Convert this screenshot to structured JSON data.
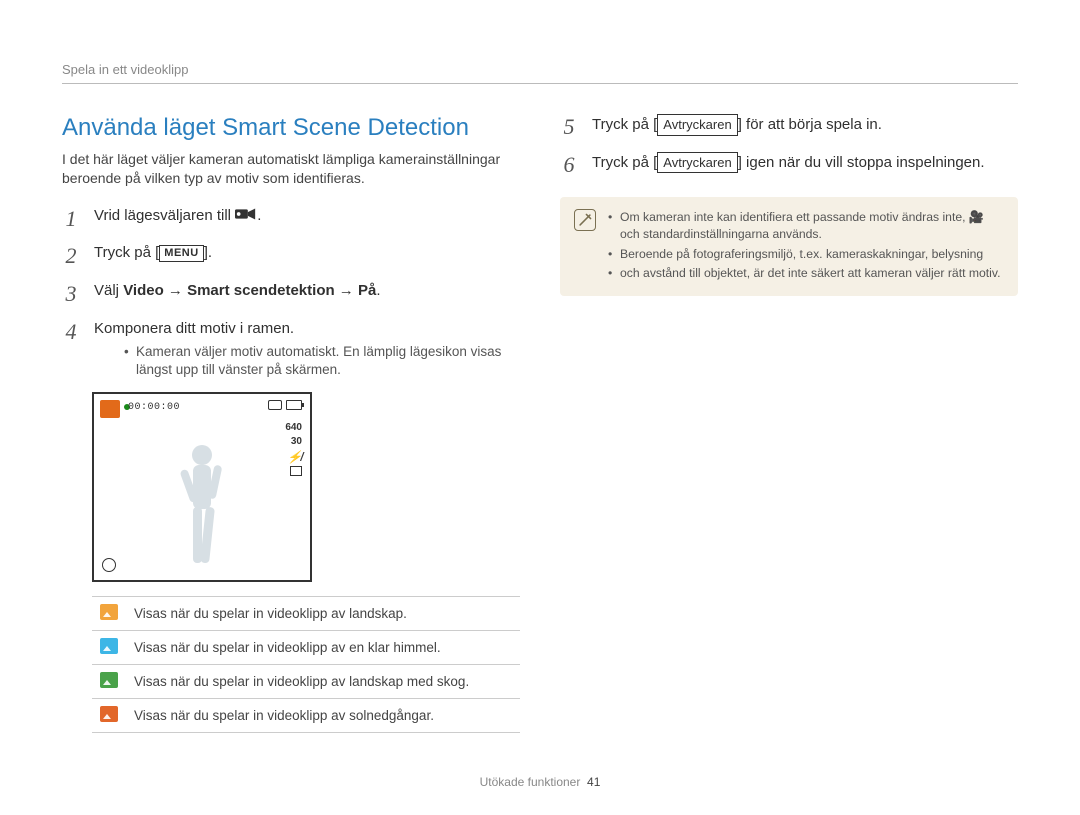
{
  "breadcrumb": "Spela in ett videoklipp",
  "section_title": "Använda läget Smart Scene Detection",
  "intro": "I det här läget väljer kameran automatiskt lämpliga kamerainställningar beroende på vilken typ av motiv som identifieras.",
  "left_steps": {
    "s1": {
      "num": "1",
      "text": "Vrid lägesväljaren till "
    },
    "s2": {
      "num": "2",
      "text_pre": "Tryck på [",
      "menu": "MENU",
      "text_post": "]."
    },
    "s3": {
      "num": "3",
      "text_pre": "Välj ",
      "bold": "Video → Smart scendetektion → På",
      "text_post": "."
    },
    "s4": {
      "num": "4",
      "text": "Komponera ditt motiv i ramen.",
      "bullet": "Kameran väljer motiv automatiskt. En lämplig lägesikon visas längst upp till vänster på skärmen."
    }
  },
  "display": {
    "time": "00:00:00",
    "res": "640",
    "fps": "30"
  },
  "icon_rows": [
    {
      "type": "landscape",
      "text": "Visas när du spelar in videoklipp av landskap."
    },
    {
      "type": "sky",
      "text": "Visas när du spelar in videoklipp av en klar himmel."
    },
    {
      "type": "forest",
      "text": "Visas när du spelar in videoklipp av landskap med skog."
    },
    {
      "type": "sunset",
      "text": "Visas när du spelar in videoklipp av solnedgångar."
    }
  ],
  "right_steps": {
    "s5": {
      "num": "5",
      "pre": "Tryck på [",
      "box": "Avtryckaren",
      "post": "] för att börja spela in."
    },
    "s6": {
      "num": "6",
      "pre": "Tryck på [",
      "box": "Avtryckaren",
      "post": "] igen när du vill stoppa inspelningen."
    }
  },
  "note": {
    "items": [
      "Om kameran inte kan identifiera ett passande motiv ändras inte, 🎥 och standardinställningarna används.",
      "Beroende på fotograferingsmiljö, t.ex. kameraskakningar, belysning",
      "och avstånd till objektet, är det inte säkert att kameran väljer rätt motiv."
    ]
  },
  "footer": {
    "label": "Utökade funktioner",
    "page": "41"
  }
}
